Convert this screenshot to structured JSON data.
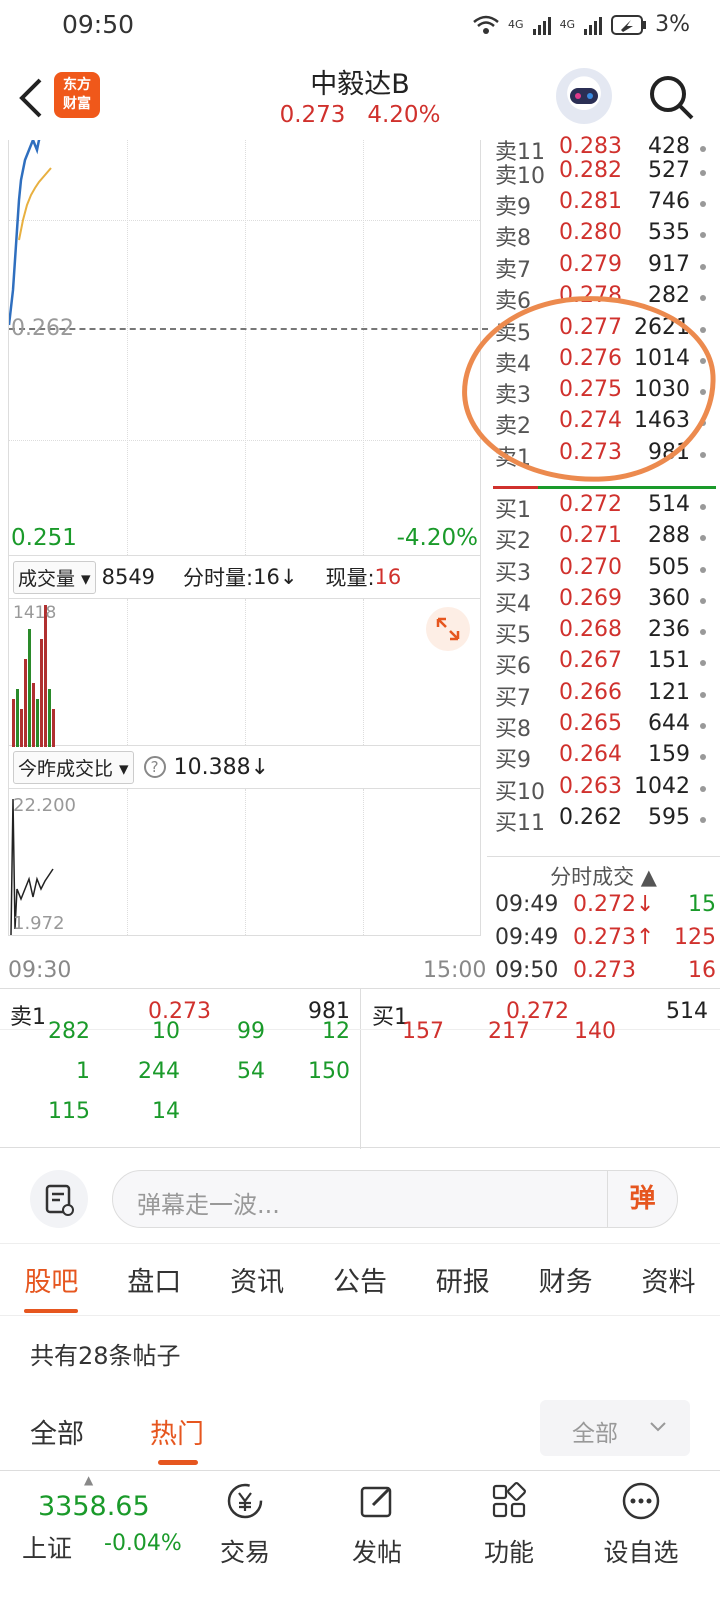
{
  "status_bar": {
    "time": "09:50",
    "signal1": "4G",
    "signal2": "4G",
    "battery": "3%"
  },
  "header": {
    "title": "中毅达B",
    "price": "0.273",
    "change_pct": "4.20%",
    "logo_line1": "东方",
    "logo_line2": "财富"
  },
  "chart": {
    "prev_close": "0.262",
    "low_price": "0.251",
    "low_pct": "-4.20%",
    "vol_selector": "成交量",
    "vol_total": "8549",
    "min_vol_label": "分时量:",
    "min_vol_value": "16",
    "cur_vol_label": "现量:",
    "cur_vol_value": "16",
    "vol_max": "1418",
    "ratio_selector": "今昨成交比",
    "ratio_value": "10.388",
    "ratio_max": "22.200",
    "ratio_min": "1.972",
    "time_start": "09:30",
    "time_end": "15:00"
  },
  "order_book": {
    "asks": [
      {
        "label": "卖11",
        "price": "0.283",
        "vol": "428"
      },
      {
        "label": "卖10",
        "price": "0.282",
        "vol": "527"
      },
      {
        "label": "卖9",
        "price": "0.281",
        "vol": "746"
      },
      {
        "label": "卖8",
        "price": "0.280",
        "vol": "535"
      },
      {
        "label": "卖7",
        "price": "0.279",
        "vol": "917"
      },
      {
        "label": "卖6",
        "price": "0.278",
        "vol": "282"
      },
      {
        "label": "卖5",
        "price": "0.277",
        "vol": "2621"
      },
      {
        "label": "卖4",
        "price": "0.276",
        "vol": "1014"
      },
      {
        "label": "卖3",
        "price": "0.275",
        "vol": "1030"
      },
      {
        "label": "卖2",
        "price": "0.274",
        "vol": "1463"
      },
      {
        "label": "卖1",
        "price": "0.273",
        "vol": "981"
      }
    ],
    "bids": [
      {
        "label": "买1",
        "price": "0.272",
        "vol": "514"
      },
      {
        "label": "买2",
        "price": "0.271",
        "vol": "288"
      },
      {
        "label": "买3",
        "price": "0.270",
        "vol": "505"
      },
      {
        "label": "买4",
        "price": "0.269",
        "vol": "360"
      },
      {
        "label": "买5",
        "price": "0.268",
        "vol": "236"
      },
      {
        "label": "买6",
        "price": "0.267",
        "vol": "151"
      },
      {
        "label": "买7",
        "price": "0.266",
        "vol": "121"
      },
      {
        "label": "买8",
        "price": "0.265",
        "vol": "644"
      },
      {
        "label": "买9",
        "price": "0.264",
        "vol": "159"
      },
      {
        "label": "买10",
        "price": "0.263",
        "vol": "1042"
      },
      {
        "label": "买11",
        "price": "0.262",
        "vol": "595"
      }
    ]
  },
  "ticks": {
    "header": "分时成交",
    "rows": [
      {
        "time": "09:49",
        "price": "0.272↓",
        "vol": "15"
      },
      {
        "time": "09:49",
        "price": "0.273↑",
        "vol": "125"
      },
      {
        "time": "09:50",
        "price": "0.273",
        "vol": "16"
      }
    ]
  },
  "queue": {
    "sell_label": "卖1",
    "sell_price": "0.273",
    "sell_vol": "981",
    "buy_label": "买1",
    "buy_price": "0.272",
    "buy_vol": "514",
    "sell_orders": [
      "282",
      "10",
      "99",
      "12",
      "1",
      "244",
      "54",
      "150",
      "115",
      "14"
    ],
    "buy_orders": [
      "157",
      "217",
      "140"
    ]
  },
  "comment": {
    "placeholder": "弹幕走一波...",
    "danmu_btn": "弹"
  },
  "tabs": [
    "股吧",
    "盘口",
    "资讯",
    "公告",
    "研报",
    "财务",
    "资料"
  ],
  "posts": {
    "count_text": "共有28条帖子",
    "filter_all": "全部",
    "filter_hot": "热门",
    "select_value": "全部"
  },
  "bottom_nav": {
    "index_value": "3358.65",
    "index_name": "上证",
    "index_change": "-0.04%",
    "items": [
      "交易",
      "发帖",
      "功能",
      "设自选"
    ]
  },
  "colors": {
    "up": "#d0312d",
    "down": "#1a9a2a",
    "accent": "#e6561f",
    "annotation": "#ec8a4e"
  }
}
